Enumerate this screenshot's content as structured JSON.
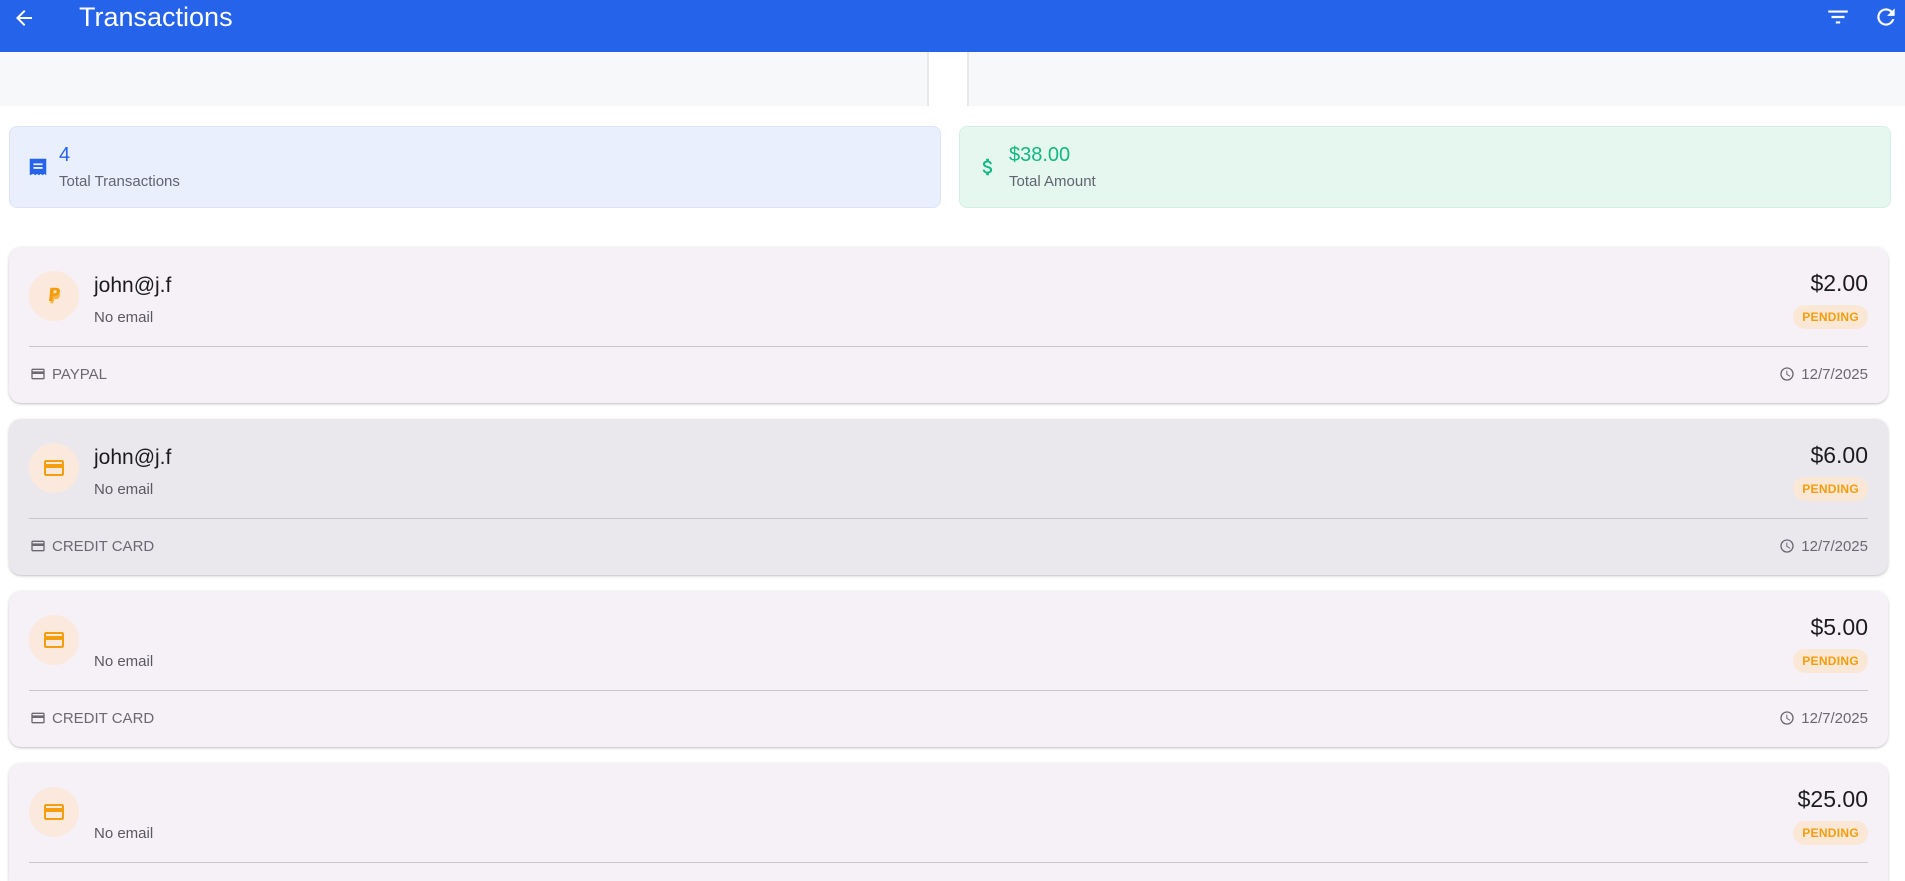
{
  "header": {
    "title": "Transactions",
    "back_icon": "arrow-back-icon",
    "filter_icon": "filter-icon",
    "refresh_icon": "refresh-icon",
    "bar_color": "#2563eb"
  },
  "summary": {
    "total_transactions": {
      "value": "4",
      "label": "Total Transactions",
      "icon": "receipt-icon",
      "color": "#2563eb"
    },
    "total_amount": {
      "value": "$38.00",
      "label": "Total Amount",
      "icon": "dollar-icon",
      "color": "#10b981"
    }
  },
  "transactions": [
    {
      "name": "john@j.f",
      "email": "No email",
      "amount": "$2.00",
      "status": "PENDING",
      "method": "PAYPAL",
      "date": "12/7/2025",
      "icon": "paypal-icon"
    },
    {
      "name": "john@j.f",
      "email": "No email",
      "amount": "$6.00",
      "status": "PENDING",
      "method": "CREDIT CARD",
      "date": "12/7/2025",
      "icon": "credit-card-icon"
    },
    {
      "name": "",
      "email": "No email",
      "amount": "$5.00",
      "status": "PENDING",
      "method": "CREDIT CARD",
      "date": "12/7/2025",
      "icon": "credit-card-icon"
    },
    {
      "name": "",
      "email": "No email",
      "amount": "$25.00",
      "status": "PENDING",
      "method": "",
      "date": "",
      "icon": "credit-card-icon"
    }
  ],
  "colors": {
    "pending": "#f59e0b",
    "pending_bg": "#fbe7d6"
  }
}
